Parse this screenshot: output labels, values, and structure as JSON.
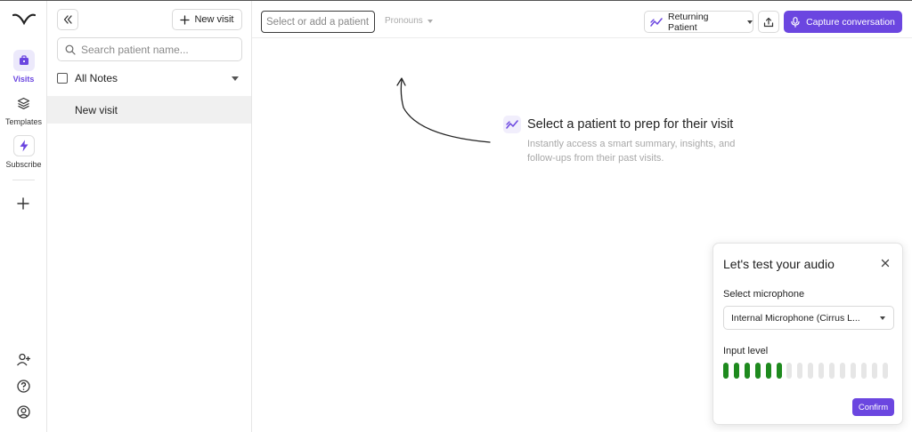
{
  "colors": {
    "accent": "#6b46e0",
    "meter_active": "#1e8a1e",
    "meter_inactive": "#e6e6e6"
  },
  "rail": {
    "logo_icon": "brand-logo-icon",
    "items": [
      {
        "label": "Visits",
        "icon": "briefcase-icon",
        "active": true
      },
      {
        "label": "Templates",
        "icon": "layers-icon",
        "active": false
      },
      {
        "label": "Subscribe",
        "icon": "lightning-icon",
        "active": false
      }
    ],
    "add_icon": "plus-icon",
    "bottom_icons": [
      "invite-user-icon",
      "help-icon",
      "account-icon"
    ]
  },
  "sidebar": {
    "collapse_icon": "double-chevron-left-icon",
    "new_visit_label": "New visit",
    "search_placeholder": "Search patient name...",
    "filter_label": "All Notes",
    "items": [
      {
        "label": "New visit",
        "selected": true
      }
    ]
  },
  "topbar": {
    "patient_placeholder": "Select or add a patient",
    "pronouns_label": "Pronouns",
    "visit_type_label": "Returning Patient",
    "share_icon": "share-icon",
    "capture_label": "Capture conversation"
  },
  "main": {
    "prompt_title": "Select a patient to prep for their visit",
    "prompt_subtitle": "Instantly access a smart summary, insights, and follow-ups from their past visits."
  },
  "audio_dialog": {
    "title": "Let's test your audio",
    "mic_label": "Select microphone",
    "mic_value": "Internal Microphone (Cirrus L...",
    "input_level_label": "Input level",
    "level_bars_total": 16,
    "level_bars_active": 6,
    "confirm_label": "Confirm"
  }
}
